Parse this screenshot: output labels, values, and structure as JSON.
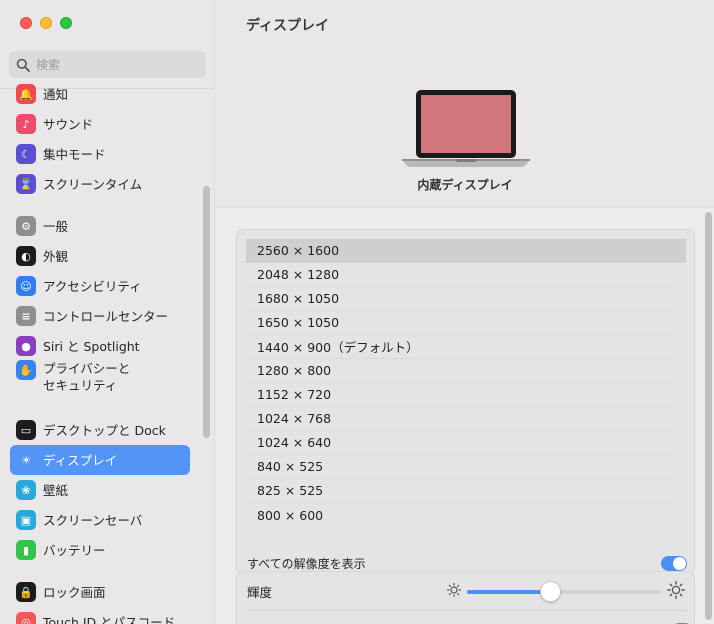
{
  "sidebar": {
    "search_placeholder": "検索",
    "items": [
      {
        "label": "通知",
        "icon": "bell-icon",
        "color": "#ef4b4b"
      },
      {
        "label": "サウンド",
        "icon": "speaker-icon",
        "color": "#ef4b6b"
      },
      {
        "label": "集中モード",
        "icon": "moon-icon",
        "color": "#5a4fd1"
      },
      {
        "label": "スクリーンタイム",
        "icon": "hourglass-icon",
        "color": "#5a4fd1"
      },
      {
        "label": "一般",
        "icon": "gear-icon",
        "color": "#8e8e93"
      },
      {
        "label": "外観",
        "icon": "appearance-icon",
        "color": "#1c1c1e"
      },
      {
        "label": "アクセシビリティ",
        "icon": "accessibility-icon",
        "color": "#2f7ff3"
      },
      {
        "label": "コントロールセンター",
        "icon": "toggles-icon",
        "color": "#8e8e93"
      },
      {
        "label": "Siri と Spotlight",
        "icon": "siri-icon",
        "color": "#8a3ec2"
      },
      {
        "label": "プライバシーと\nセキュリティ",
        "icon": "hand-icon",
        "color": "#3b82f0"
      },
      {
        "label": "デスクトップと Dock",
        "icon": "dock-icon",
        "color": "#1c1c1e"
      },
      {
        "label": "ディスプレイ",
        "icon": "sun-icon",
        "color": "#3b82f0",
        "selected": true
      },
      {
        "label": "壁紙",
        "icon": "flower-icon",
        "color": "#2aa9d8"
      },
      {
        "label": "スクリーンセーバ",
        "icon": "screensaver-icon",
        "color": "#2aa9d8"
      },
      {
        "label": "バッテリー",
        "icon": "battery-icon",
        "color": "#36c34a"
      },
      {
        "label": "ロック画面",
        "icon": "lock-icon",
        "color": "#1c1c1e"
      },
      {
        "label": "Touch ID とパスコード",
        "icon": "fingerprint-icon",
        "color": "#f25a5a"
      }
    ]
  },
  "main": {
    "title": "ディスプレイ",
    "display_name": "内蔵ディスプレイ",
    "resolutions": [
      "2560 × 1600",
      "2048 × 1280",
      "1680 × 1050",
      "1650 × 1050",
      "1440 × 900（デフォルト）",
      "1280 × 800",
      "1152 × 720",
      "1024 × 768",
      "1024 × 640",
      "840 × 525",
      "825 × 525",
      "800 × 600"
    ],
    "selected_resolution_index": 0,
    "show_all_label": "すべての解像度を表示",
    "show_all_on": true,
    "brightness_label": "輝度",
    "brightness_level": 0.43,
    "accent_color": "#4b8ff0",
    "screen_color": "#d4777c"
  }
}
